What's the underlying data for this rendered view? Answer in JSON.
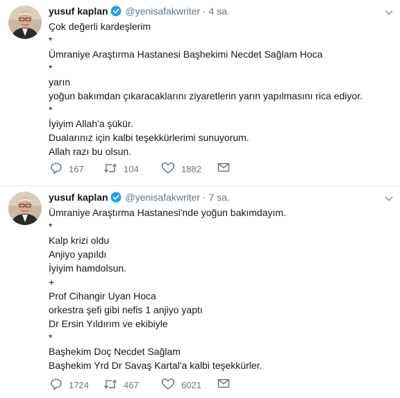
{
  "tweets": [
    {
      "name": "yusuf kaplan",
      "handle": "@yenisafakwriter",
      "time": "4 sa.",
      "lines": [
        "Çok değerli kardeşlerim",
        "*",
        "Ümraniye Araştırma Hastanesi Başhekimi Necdet Sağlam Hoca",
        "*",
        "yarın",
        "yoğun bakımdan çıkaracaklarını ziyaretlerin yarın yapılmasını rica ediyor.",
        "*",
        "İyiyim Allah'a şükür.",
        "Dualarınız için kalbi teşekkürlerimi sunuyorum.",
        "Allah razı bu olsun."
      ],
      "replies": "167",
      "retweets": "104",
      "likes": "1882"
    },
    {
      "name": "yusuf kaplan",
      "handle": "@yenisafakwriter",
      "time": "7 sa.",
      "lines": [
        "Ümraniye Araştırma Hastanesi'nde yoğun bakımdayım.",
        "*",
        "Kalp krizi oldu",
        "Anjiyo yapıldı",
        "İyiyim hamdolsun.",
        "+",
        "Prof Cihangir Uyan Hoca",
        "orkestra şefi gibi nefis 1 anjiyo yaptı",
        "Dr Ersin Yıldırım ve ekibiyle",
        "*",
        "Başhekim Doç Necdet Sağlam",
        "Başhekim Yrd Dr Savaş Kartal'a kalbi teşekkürler."
      ],
      "replies": "1724",
      "retweets": "467",
      "likes": "6021"
    }
  ],
  "separator": "·",
  "icons": {
    "verified": "verified-badge-icon",
    "caret": "chevron-down-icon",
    "reply": "reply-icon",
    "retweet": "retweet-icon",
    "like": "heart-icon",
    "dm": "envelope-icon"
  },
  "colors": {
    "verified": "#1da1f2",
    "muted": "#657786",
    "text": "#14171a",
    "divider": "#e6ecf0"
  }
}
